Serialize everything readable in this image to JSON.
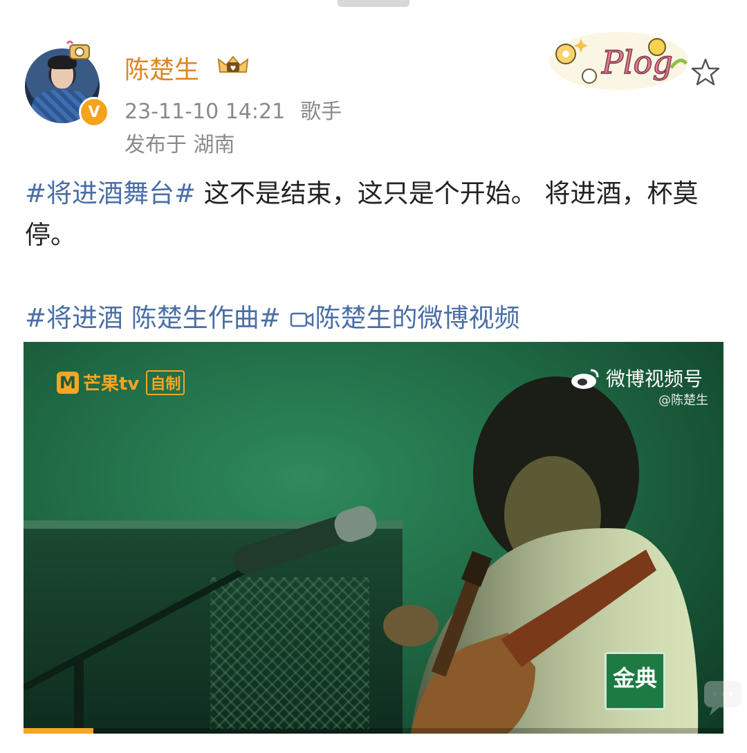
{
  "user": {
    "name": "陈楚生",
    "verified_badge": "V",
    "timestamp": "23-11-10 14:21",
    "source": "歌手",
    "location": "发布于 湖南"
  },
  "decor": {
    "sticker_text": "Plog"
  },
  "post": {
    "line1_tag": "#将进酒舞台#",
    "line1_text": " 这不是结束，这只是个开始。 将进酒，杯莫停。",
    "line2_tag": "#将进酒 陈楚生作曲#",
    "line2_link": "陈楚生的微博视频"
  },
  "video": {
    "channel_logo_letter": "M",
    "channel_name": "芒果tv",
    "channel_badge": "自制",
    "watermark": "微博视频号",
    "watermark_handle": "@陈楚生",
    "brand_text": "金典",
    "progress": 0.1
  },
  "colors": {
    "username": "#e0851f",
    "link": "#4a6ea6",
    "accent": "#f5a623"
  }
}
